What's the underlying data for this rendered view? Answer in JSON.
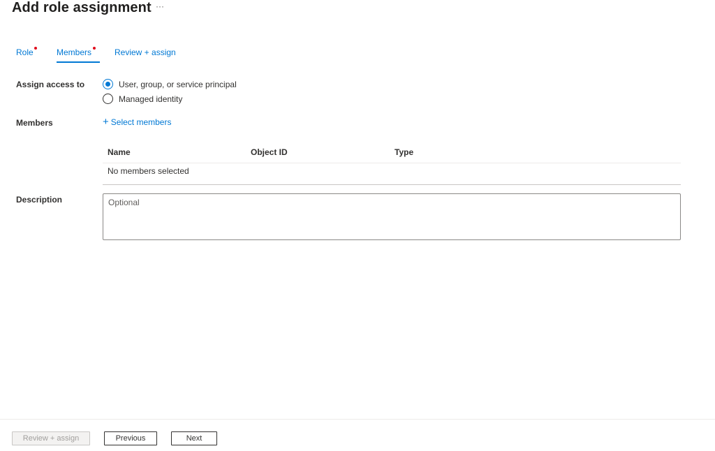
{
  "header": {
    "title": "Add role assignment",
    "more_label": "···"
  },
  "tabs": [
    {
      "label": "Role",
      "required": true,
      "active": false
    },
    {
      "label": "Members",
      "required": true,
      "active": true
    },
    {
      "label": "Review + assign",
      "required": false,
      "active": false
    }
  ],
  "form": {
    "assign_access_label": "Assign access to",
    "assign_options": [
      {
        "label": "User, group, or service principal",
        "selected": true
      },
      {
        "label": "Managed identity",
        "selected": false
      }
    ],
    "members_label": "Members",
    "select_members_label": "Select members",
    "description_label": "Description",
    "description_placeholder": "Optional",
    "description_value": ""
  },
  "members_table": {
    "columns": [
      "Name",
      "Object ID",
      "Type"
    ],
    "empty_text": "No members selected"
  },
  "footer": {
    "review_assign_label": "Review + assign",
    "previous_label": "Previous",
    "next_label": "Next"
  },
  "colors": {
    "accent": "#0078d4",
    "required_dot": "#e00b1c"
  }
}
